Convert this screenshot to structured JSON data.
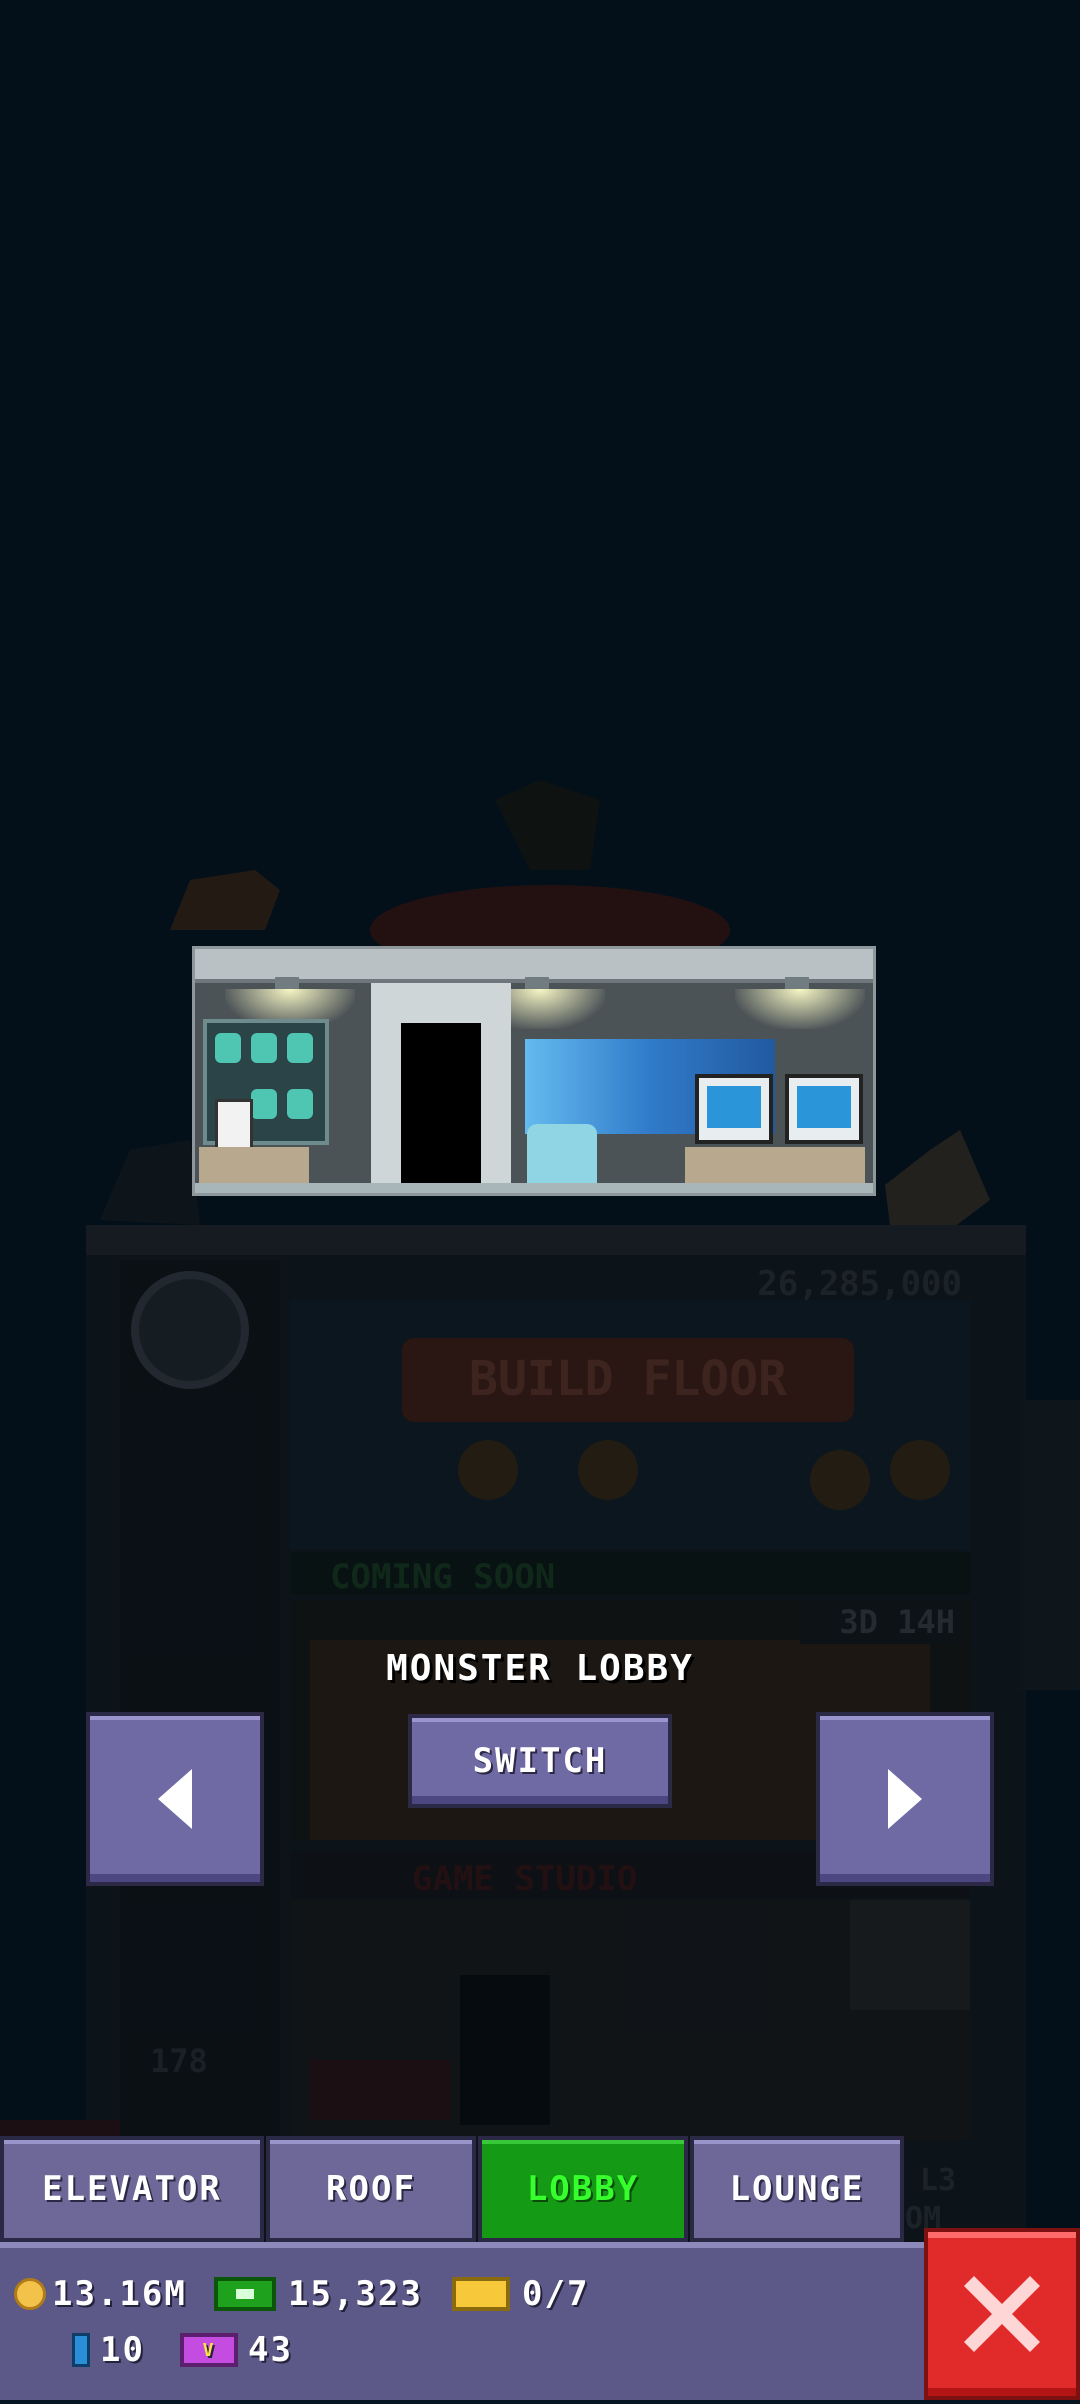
{
  "tower": {
    "build_floor_cost": "26,285,000",
    "build_floor_label": "BUILD FLOOR",
    "coming_soon_label": "COMING SOON",
    "timer": "3D 14H",
    "floor_name": "GAME STUDIO",
    "floor_number": "178",
    "side_floor_label": "L3",
    "side_floor_sub": "OM"
  },
  "lobby_preview": {
    "name": "MONSTER LOBBY",
    "switch_label": "SWITCH"
  },
  "tabs": [
    {
      "label": "ELEVATOR",
      "active": false
    },
    {
      "label": "ROOF",
      "active": false
    },
    {
      "label": "LOBBY",
      "active": true
    },
    {
      "label": "LOUNGE",
      "active": false
    }
  ],
  "status": {
    "coins": "13.16M",
    "bux": "15,323",
    "tickets": "0/7",
    "books": "10",
    "vip": "43",
    "vip_icon_text": "V"
  },
  "colors": {
    "background": "#061520",
    "active_tab": "#159a16",
    "button": "#6f6aa3",
    "close": "#e12b2b"
  },
  "icons": [
    "coin-icon",
    "bux-icon",
    "ticket-icon",
    "book-icon",
    "vip-icon",
    "close-icon",
    "arrow-left-icon",
    "arrow-right-icon"
  ]
}
